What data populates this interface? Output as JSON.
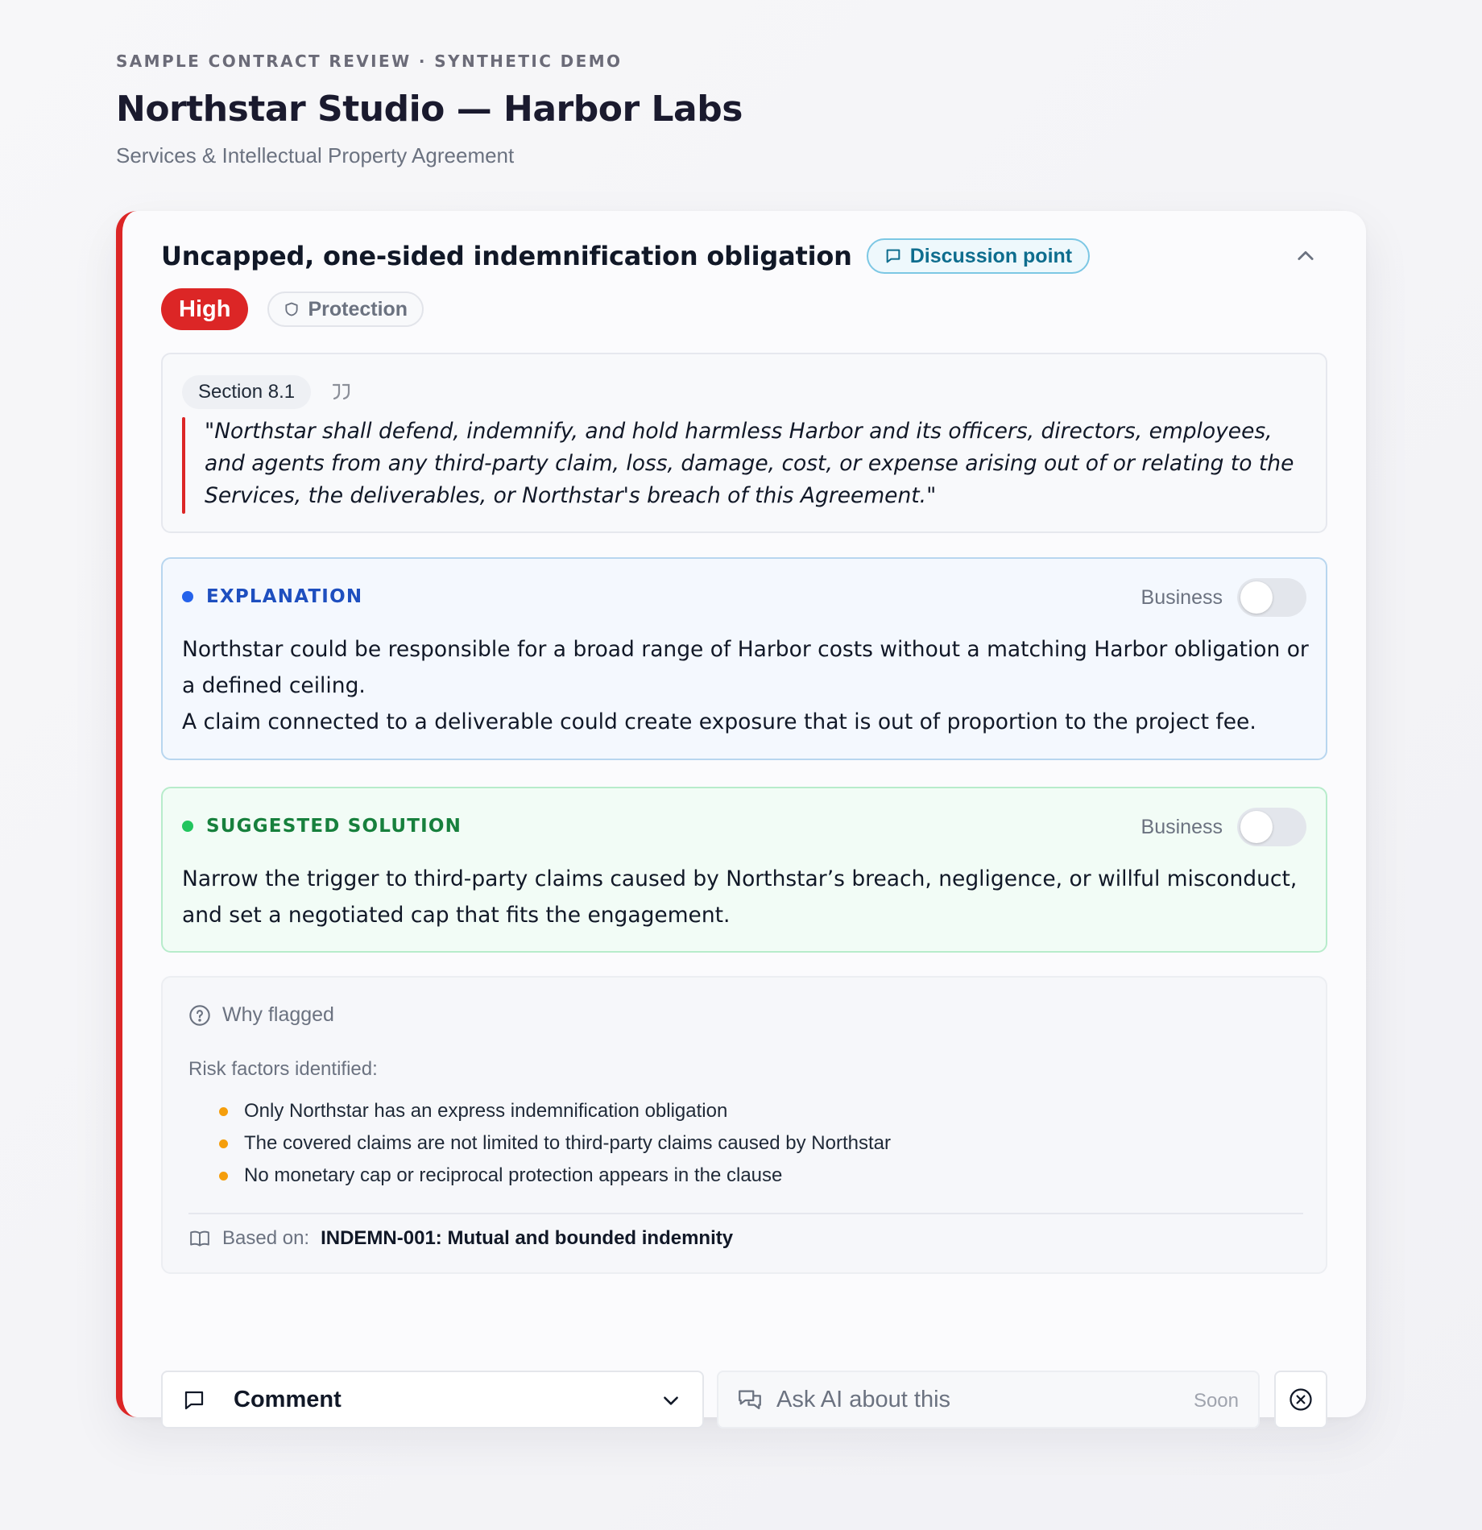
{
  "header": {
    "eyebrow": "SAMPLE CONTRACT REVIEW · SYNTHETIC DEMO",
    "title": "Northstar Studio — Harbor Labs",
    "subtitle": "Services & Intellectual Property Agreement"
  },
  "issue": {
    "title": "Uncapped, one-sided indemnification obligation",
    "discussion_label": "Discussion point",
    "severity": "High",
    "category": "Protection",
    "colors": {
      "severity": "#dc2626",
      "explanation_accent": "#2563eb",
      "solution_accent": "#16a34a",
      "risk_bullet": "#f59e0b"
    }
  },
  "quote": {
    "section": "Section 8.1",
    "text": "\"Northstar shall defend, indemnify, and hold harmless Harbor and its officers, directors, employees, and agents from any third-party claim, loss, damage, cost, or expense arising out of or relating to the Services, the deliverables, or Northstar's breach of this Agreement.\""
  },
  "explanation": {
    "label": "EXPLANATION",
    "toggle_label": "Business",
    "toggle_on": false,
    "lines": [
      "Northstar could be responsible for a broad range of Harbor costs without a matching Harbor obligation or a defined ceiling.",
      "A claim connected to a deliverable could create exposure that is out of proportion to the project fee."
    ]
  },
  "solution": {
    "label": "SUGGESTED SOLUTION",
    "toggle_label": "Business",
    "toggle_on": false,
    "text": "Narrow the trigger to third-party claims caused by Northstar’s breach, negligence, or willful misconduct, and set a negotiated cap that fits the engagement."
  },
  "why_flagged": {
    "heading": "Why flagged",
    "risk_label": "Risk factors identified:",
    "risks": [
      "Only Northstar has an express indemnification obligation",
      "The covered claims are not limited to third-party claims caused by Northstar",
      "No monetary cap or reciprocal protection appears in the clause"
    ],
    "based_on_label": "Based on:",
    "based_on_value": "INDEMN-001: Mutual and bounded indemnity"
  },
  "actions": {
    "comment_label": "Comment",
    "ask_ai_label": "Ask AI about this",
    "ask_ai_badge": "Soon"
  },
  "icons": {
    "discussion": "speech-bubble-icon",
    "category": "shield-icon",
    "collapse": "chevron-up-icon",
    "quote": "quote-marks-icon",
    "why": "question-circle-icon",
    "based_on": "book-icon",
    "comment": "speech-bubble-icon",
    "comment_dropdown": "chevron-down-icon",
    "ask_ai": "chat-bubbles-icon",
    "dismiss": "close-circle-icon"
  }
}
